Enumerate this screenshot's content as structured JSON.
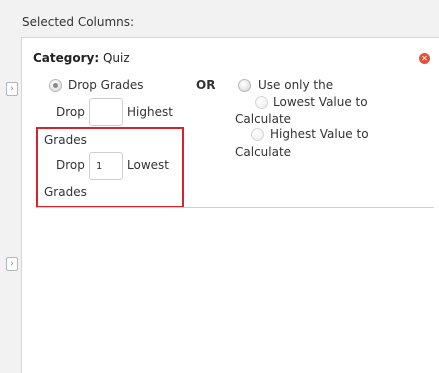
{
  "header": {
    "title": "Selected Columns:"
  },
  "category": {
    "label": "Category:",
    "name": "Quiz"
  },
  "icons": {
    "close": "close-icon",
    "expand": "chevron-right-icon"
  },
  "drop": {
    "option_label": "Drop Grades",
    "drop_word": "Drop",
    "highest_label": "Highest",
    "grades_word": "Grades",
    "highest_value": "",
    "lowest_label": "Lowest",
    "lowest_value": "1"
  },
  "or_label": "OR",
  "use_only": {
    "label": "Use only the",
    "lowest_label": "Lowest Value to",
    "calculate_word": "Calculate",
    "highest_label": "Highest Value to"
  },
  "colors": {
    "highlight": "#d7232a",
    "close": "#e2513a"
  }
}
